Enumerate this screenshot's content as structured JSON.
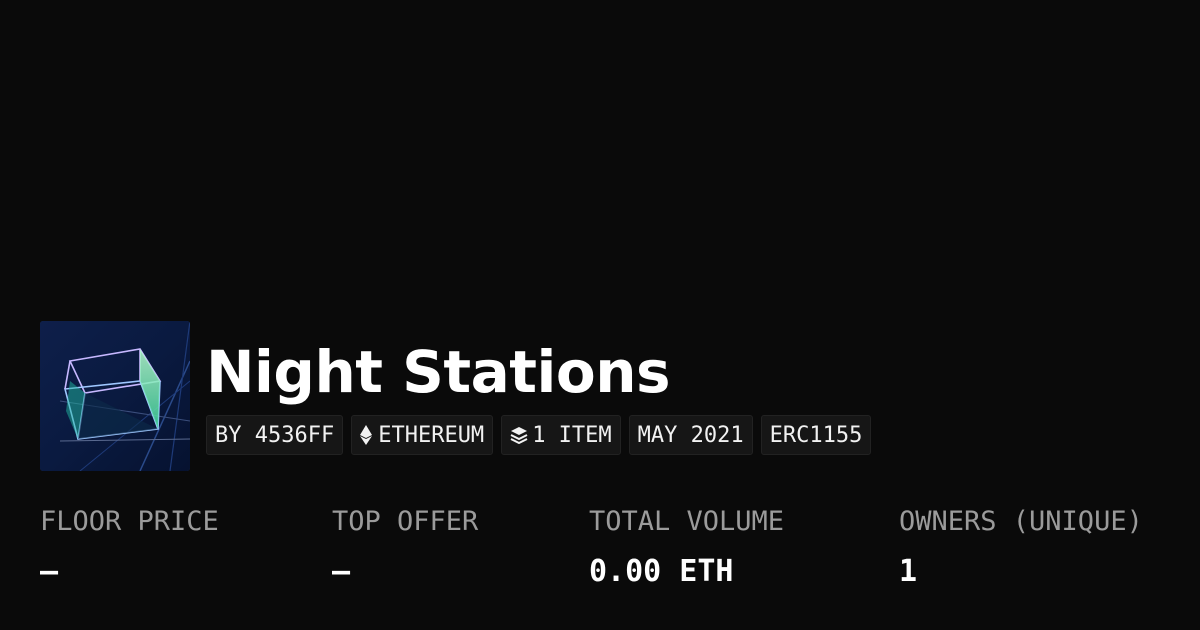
{
  "collection": {
    "title": "Night Stations",
    "avatar_icon": "wireframe-cube-artwork"
  },
  "chips": {
    "creator": "BY 4536FF",
    "chain": "ETHEREUM",
    "chain_icon": "ethereum-icon",
    "items": "1 ITEM",
    "items_icon": "layers-icon",
    "date": "MAY 2021",
    "standard": "ERC1155"
  },
  "stats": {
    "floor_price": {
      "label": "FLOOR PRICE",
      "value": "—"
    },
    "top_offer": {
      "label": "TOP OFFER",
      "value": "—"
    },
    "total_volume": {
      "label": "TOTAL VOLUME",
      "value": "0.00 ETH"
    },
    "owners": {
      "label": "OWNERS (UNIQUE)",
      "value": "1"
    }
  },
  "colors": {
    "background": "#0a0a0a",
    "chip_background": "#161616",
    "label": "#9b9b9b",
    "value": "#ffffff"
  }
}
